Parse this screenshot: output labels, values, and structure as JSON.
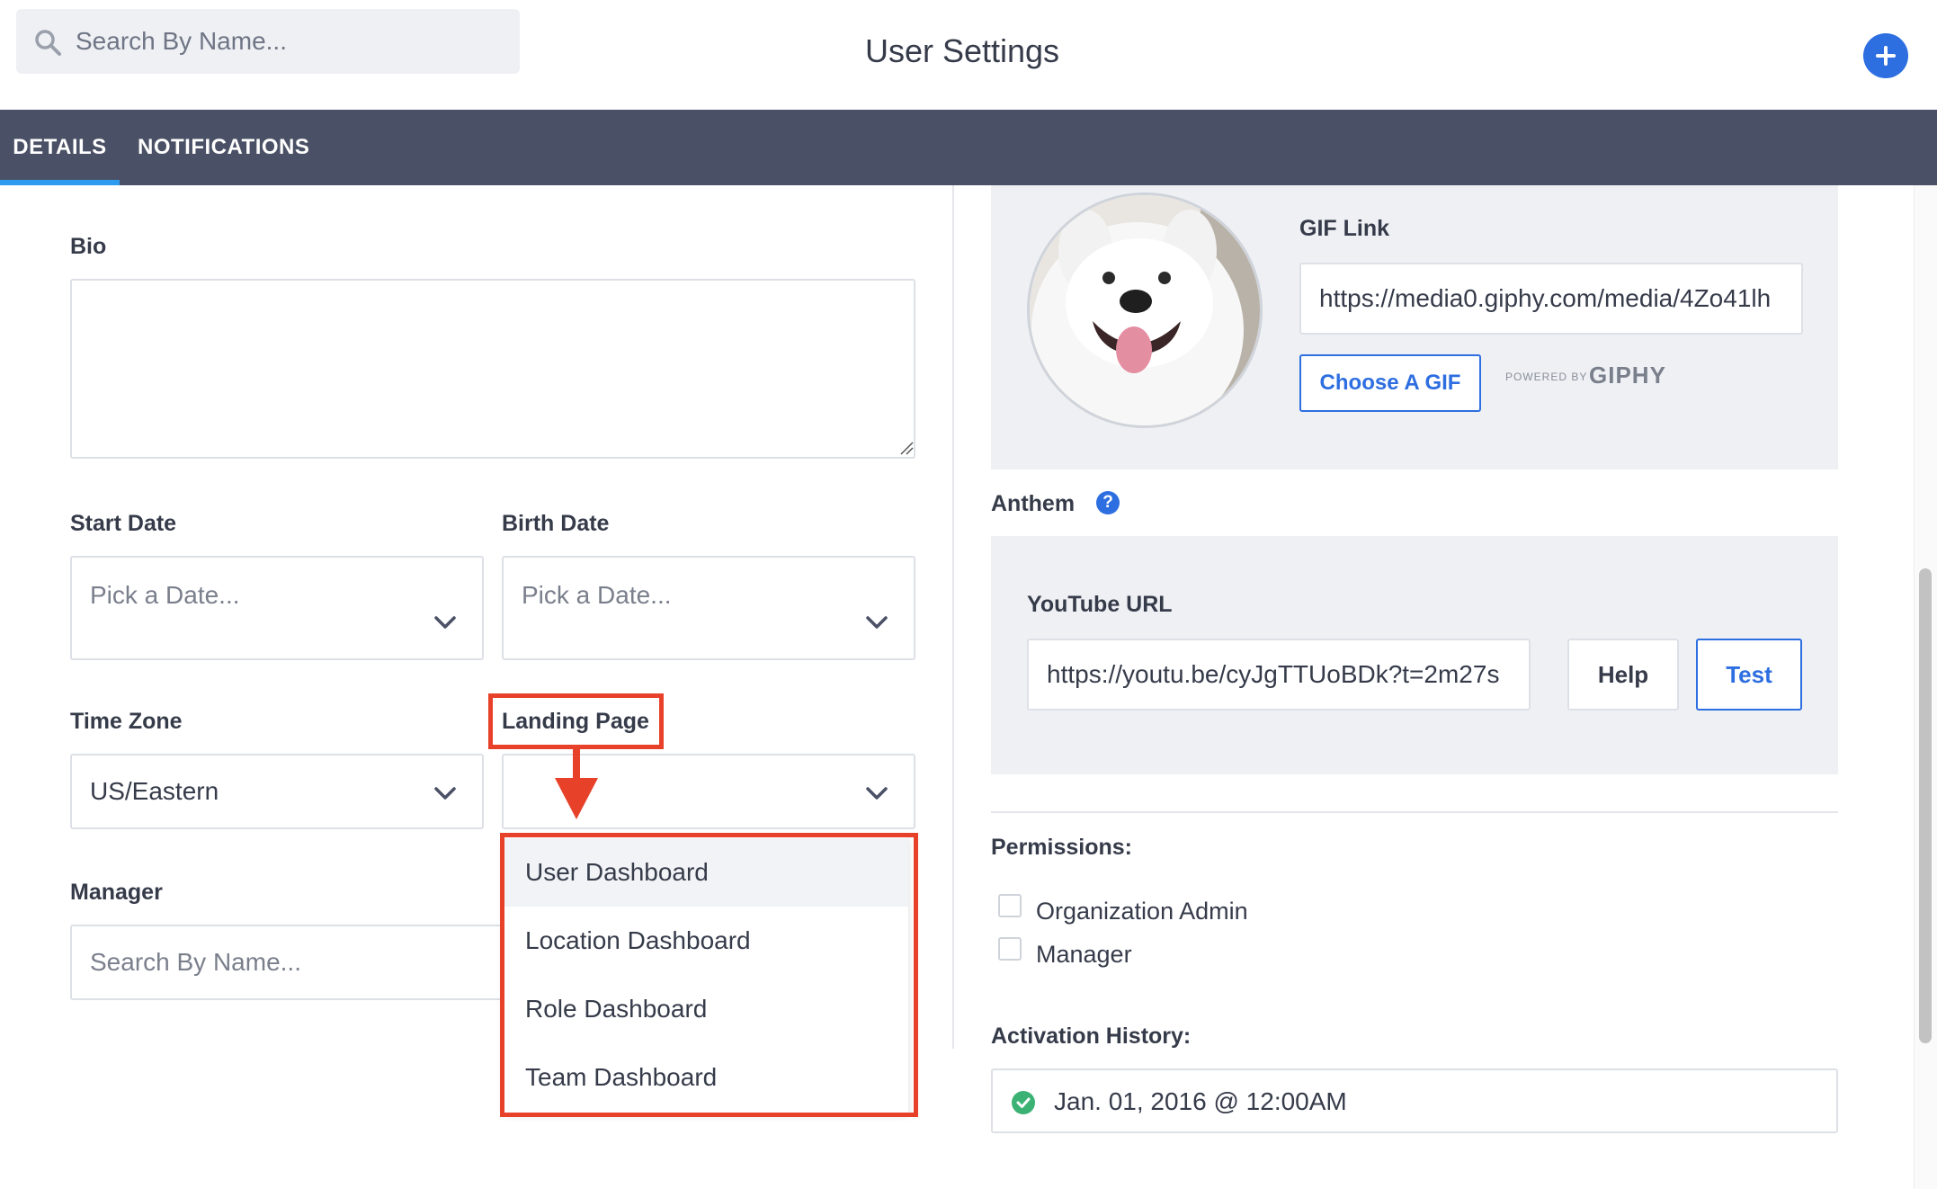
{
  "header": {
    "search_placeholder": "Search By Name...",
    "title": "User Settings",
    "add_icon": "plus-icon"
  },
  "tabs": [
    {
      "label": "DETAILS",
      "active": true
    },
    {
      "label": "NOTIFICATIONS",
      "active": false
    }
  ],
  "form": {
    "bio_label": "Bio",
    "bio_value": "",
    "start_date_label": "Start Date",
    "start_date_placeholder": "Pick a Date...",
    "birth_date_label": "Birth Date",
    "birth_date_placeholder": "Pick a Date...",
    "time_zone_label": "Time Zone",
    "time_zone_value": "US/Eastern",
    "landing_page_label": "Landing Page",
    "landing_page_value": "",
    "landing_page_options": [
      "User Dashboard",
      "Location Dashboard",
      "Role Dashboard",
      "Team Dashboard"
    ],
    "manager_label": "Manager",
    "manager_placeholder": "Search By Name..."
  },
  "gif": {
    "label": "GIF Link",
    "value": "https://media0.giphy.com/media/4Zo41lh",
    "choose_button": "Choose A GIF",
    "powered_by": "POWERED BY",
    "brand": "GIPHY"
  },
  "anthem": {
    "label": "Anthem",
    "youtube_label": "YouTube URL",
    "youtube_value": "https://youtu.be/cyJgTTUoBDk?t=2m27s",
    "help_button": "Help",
    "test_button": "Test"
  },
  "permissions": {
    "label": "Permissions:",
    "items": [
      {
        "label": "Organization Admin",
        "checked": false
      },
      {
        "label": "Manager",
        "checked": false
      }
    ]
  },
  "activation": {
    "label": "Activation History:",
    "entries": [
      {
        "text": "Jan. 01, 2016 @ 12:00AM",
        "status": "success"
      }
    ]
  },
  "colors": {
    "accent": "#2d6ee0",
    "tabbar": "#4a5065",
    "tab_indicator": "#2d9cf0",
    "annotation": "#e8412a",
    "success": "#3bb273"
  }
}
